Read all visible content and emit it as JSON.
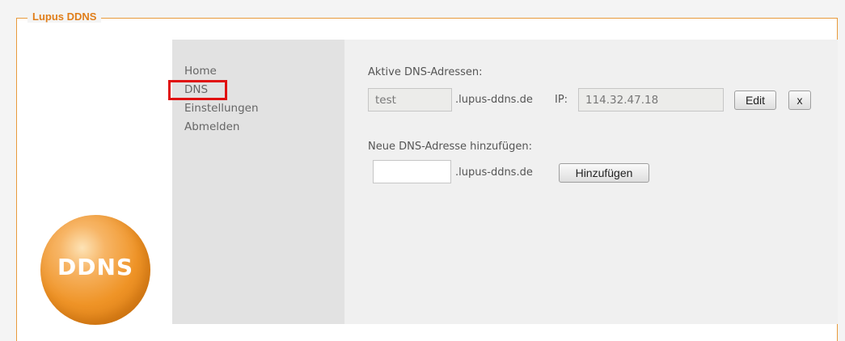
{
  "legend": "Lupus DDNS",
  "nav": [
    {
      "label": "Home"
    },
    {
      "label": "DNS"
    },
    {
      "label": "Einstellungen"
    },
    {
      "label": "Abmelden"
    }
  ],
  "active": {
    "heading": "Aktive DNS-Adressen:",
    "name_value": "test",
    "domain_suffix": ".lupus-ddns.de",
    "ip_label": "IP:",
    "ip_value": "114.32.47.18",
    "edit_label": "Edit",
    "delete_label": "x"
  },
  "add": {
    "heading": "Neue DNS-Adresse hinzufügen:",
    "name_value": "",
    "domain_suffix": ".lupus-ddns.de",
    "button_label": "Hinzufügen"
  },
  "logo": {
    "text": "DDNS"
  },
  "colors": {
    "accent": "#e07e1a",
    "highlight": "#e01010",
    "nav_bg": "#e2e2e2"
  }
}
